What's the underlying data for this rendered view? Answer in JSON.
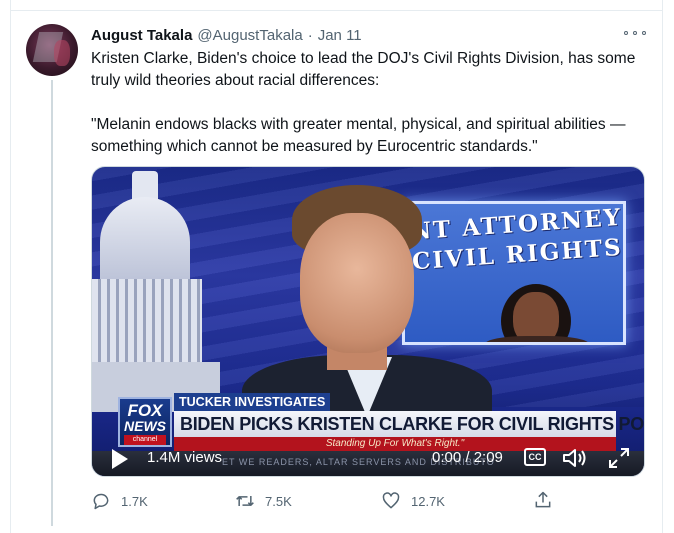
{
  "tweet": {
    "author_name": "August Takala",
    "author_handle": "@AugustTakala",
    "separator": "·",
    "date": "Jan 11",
    "text_line1": "Kristen Clarke, Biden's choice to lead the DOJ's Civil Rights Division, has some truly wild theories about racial differences:",
    "text_line2": "\"Melanin endows blacks with greater mental, physical, and spiritual abilities — something which cannot be measured by Eurocentric standards.\""
  },
  "video": {
    "screen_line1": "NT ATTORNEY",
    "screen_line2": "CIVIL RIGHTS",
    "chyron_tag": "TUCKER INVESTIGATES",
    "chyron_headline": "BIDEN PICKS KRISTEN CLARKE FOR CIVIL RIGHTS POST",
    "chyron_sub": "Standing Up For What's Right.\"",
    "logo_fox": "FOX",
    "logo_news": "NEWS",
    "logo_channel": "channel",
    "ticker": "ET WE READERS, ALTAR SERVERS AND DISTRIBUTO",
    "views": "1.4M views",
    "time": "0:00 / 2:09",
    "cc_label": "CC"
  },
  "actions": {
    "replies": "1.7K",
    "retweets": "7.5K",
    "likes": "12.7K"
  },
  "icons": {
    "more": "more-icon",
    "reply": "reply-icon",
    "retweet": "retweet-icon",
    "like": "like-icon",
    "share": "share-icon",
    "play": "play-icon",
    "volume": "volume-icon",
    "fullscreen": "fullscreen-icon"
  },
  "colors": {
    "text": "#0f1419",
    "muted": "#536471",
    "border": "#e6ecf0"
  }
}
